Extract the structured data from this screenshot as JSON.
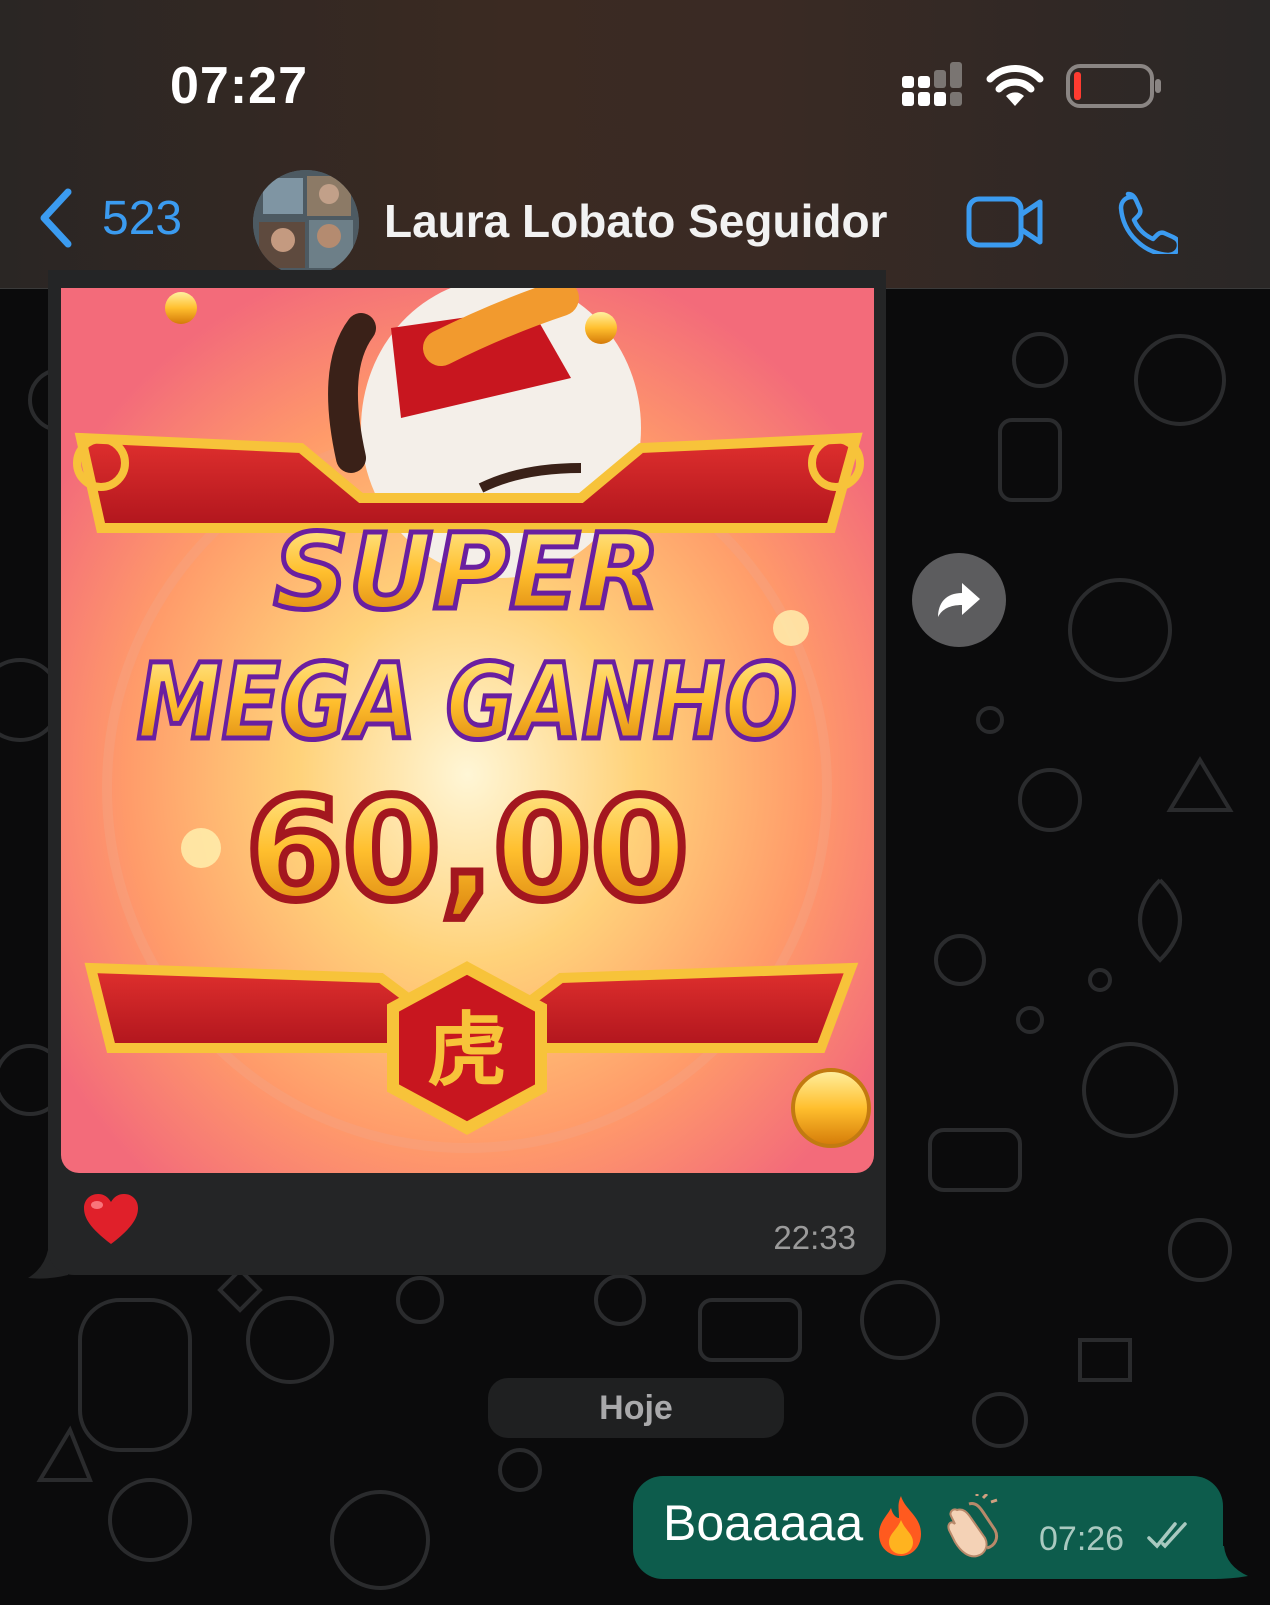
{
  "status_bar": {
    "time": "07:27",
    "battery_level": 0.08
  },
  "header": {
    "back_count": "523",
    "contact_name": "Laura Lobato Seguidor",
    "icons": [
      "chevron-left-icon",
      "video-call-icon",
      "phone-icon"
    ]
  },
  "messages": {
    "received": {
      "image_text": {
        "line1": "SUPER",
        "line2": "MEGA GANHO",
        "amount": "60,00",
        "emblem": "虎"
      },
      "reaction": "❤️",
      "time": "22:33"
    },
    "date_separator": "Hoje",
    "sent": {
      "text": "Boaaaaa",
      "emoji": "🔥 👏🏻",
      "time": "07:26",
      "status": "read"
    }
  },
  "colors": {
    "accent_blue": "#3b9bf0",
    "sent_bubble": "#0d5c4c",
    "received_bubble": "#242526",
    "battery_low": "#ff3b30"
  }
}
